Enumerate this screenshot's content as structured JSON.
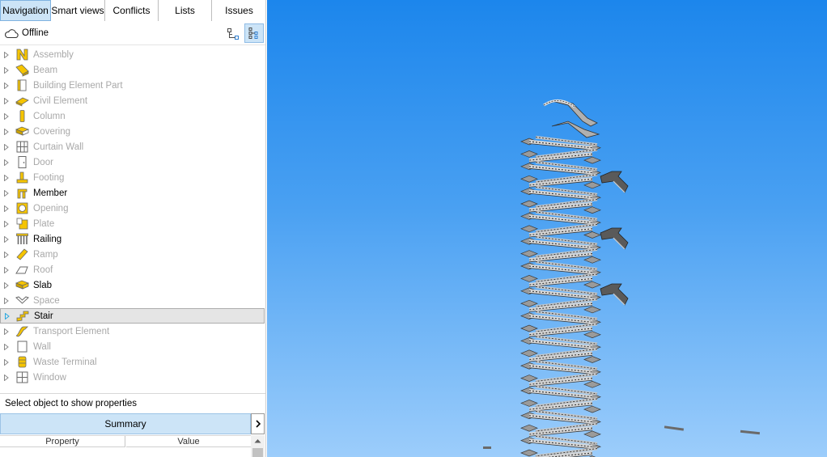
{
  "tabs": [
    {
      "label": "Navigation",
      "active": true
    },
    {
      "label": "Smart views",
      "active": false
    },
    {
      "label": "Conflicts",
      "active": false
    },
    {
      "label": "Lists",
      "active": false
    },
    {
      "label": "Issues",
      "active": false
    }
  ],
  "status": {
    "label": "Offline",
    "icon": "cloud-icon"
  },
  "tree": [
    {
      "label": "Assembly",
      "icon": "assembly-icon",
      "enabled": false
    },
    {
      "label": "Beam",
      "icon": "beam-icon",
      "enabled": false
    },
    {
      "label": "Building Element Part",
      "icon": "building-element-part-icon",
      "enabled": false
    },
    {
      "label": "Civil Element",
      "icon": "civil-element-icon",
      "enabled": false
    },
    {
      "label": "Column",
      "icon": "column-icon",
      "enabled": false
    },
    {
      "label": "Covering",
      "icon": "covering-icon",
      "enabled": false
    },
    {
      "label": "Curtain Wall",
      "icon": "curtain-wall-icon",
      "enabled": false
    },
    {
      "label": "Door",
      "icon": "door-icon",
      "enabled": false
    },
    {
      "label": "Footing",
      "icon": "footing-icon",
      "enabled": false
    },
    {
      "label": "Member",
      "icon": "member-icon",
      "enabled": true
    },
    {
      "label": "Opening",
      "icon": "opening-icon",
      "enabled": false
    },
    {
      "label": "Plate",
      "icon": "plate-icon",
      "enabled": false
    },
    {
      "label": "Railing",
      "icon": "railing-icon",
      "enabled": true
    },
    {
      "label": "Ramp",
      "icon": "ramp-icon",
      "enabled": false
    },
    {
      "label": "Roof",
      "icon": "roof-icon",
      "enabled": false
    },
    {
      "label": "Slab",
      "icon": "slab-icon",
      "enabled": true
    },
    {
      "label": "Space",
      "icon": "space-icon",
      "enabled": false
    },
    {
      "label": "Stair",
      "icon": "stair-icon",
      "enabled": true,
      "selected": true
    },
    {
      "label": "Transport Element",
      "icon": "transport-element-icon",
      "enabled": false
    },
    {
      "label": "Wall",
      "icon": "wall-icon",
      "enabled": false
    },
    {
      "label": "Waste Terminal",
      "icon": "waste-terminal-icon",
      "enabled": false
    },
    {
      "label": "Window",
      "icon": "window-icon",
      "enabled": false
    }
  ],
  "properties": {
    "hint": "Select object to show properties",
    "summary_label": "Summary",
    "columns": [
      "Property",
      "Value"
    ]
  },
  "colors": {
    "tab_active": "#cce4f7",
    "icon_yellow": "#f5c400",
    "sky_top": "#1c86ec",
    "sky_bottom": "#9ccdfb"
  }
}
